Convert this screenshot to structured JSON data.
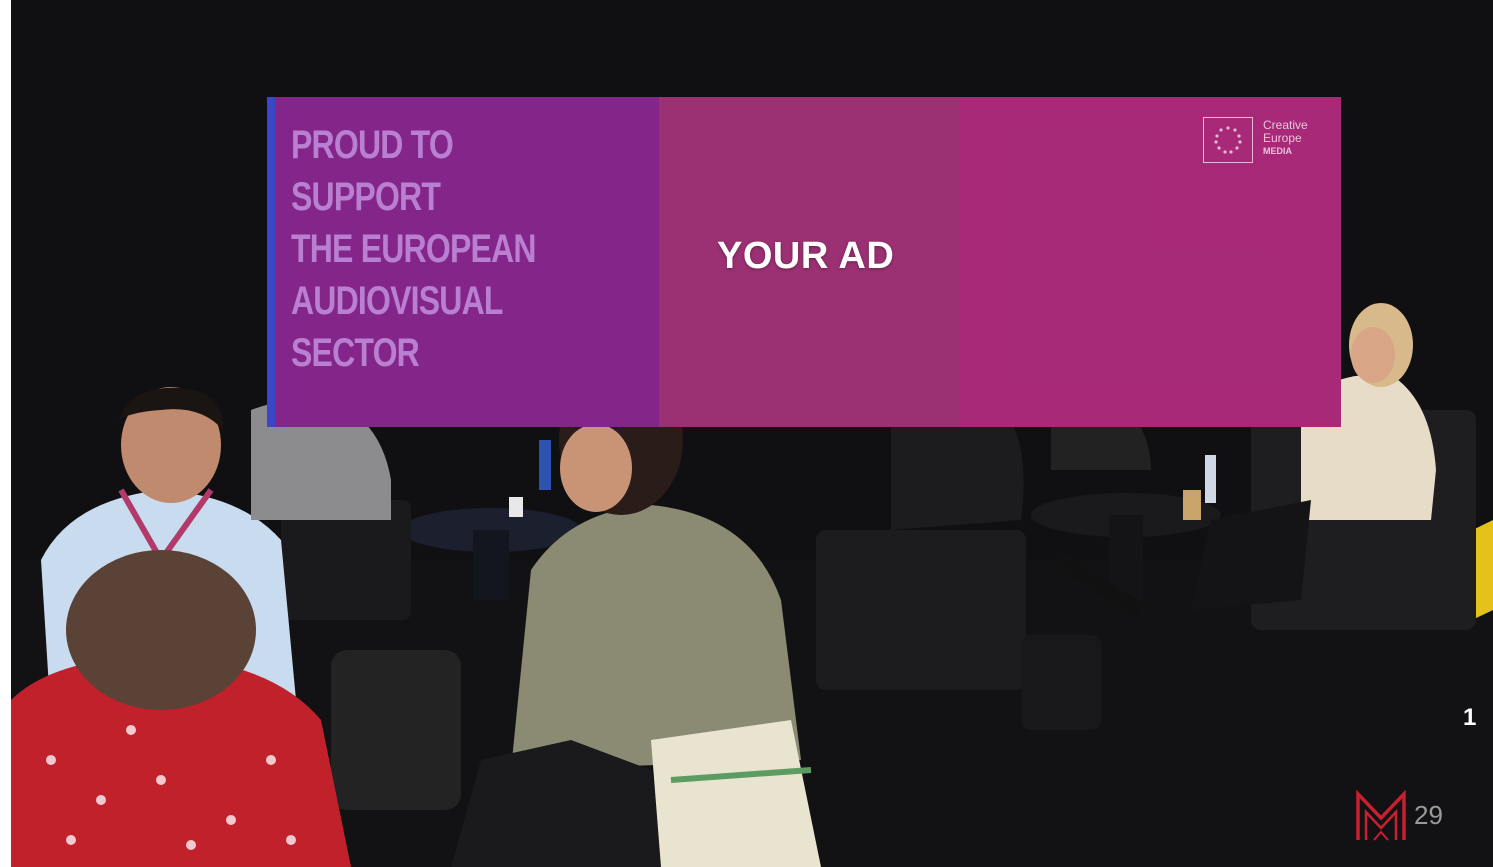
{
  "banner": {
    "headline": "PROUD TO SUPPORT\nTHE EUROPEAN\nAUDIOVISUAL SECTOR",
    "ad_label": "YOUR AD",
    "logo_text": "Creative\nEurope",
    "logo_subtext": "MEDIA"
  },
  "slide": {
    "number": "1",
    "page_number": "29"
  },
  "colors": {
    "banner_magenta": "#9a2f74",
    "banner_purple": "#6a2a8c",
    "brand_red": "#c8202f",
    "floor_stripe_yellow": "#e5c21a"
  },
  "icons": {
    "brand_logo": "m-monogram-logo",
    "eu_flag": "eu-stars-logo"
  }
}
